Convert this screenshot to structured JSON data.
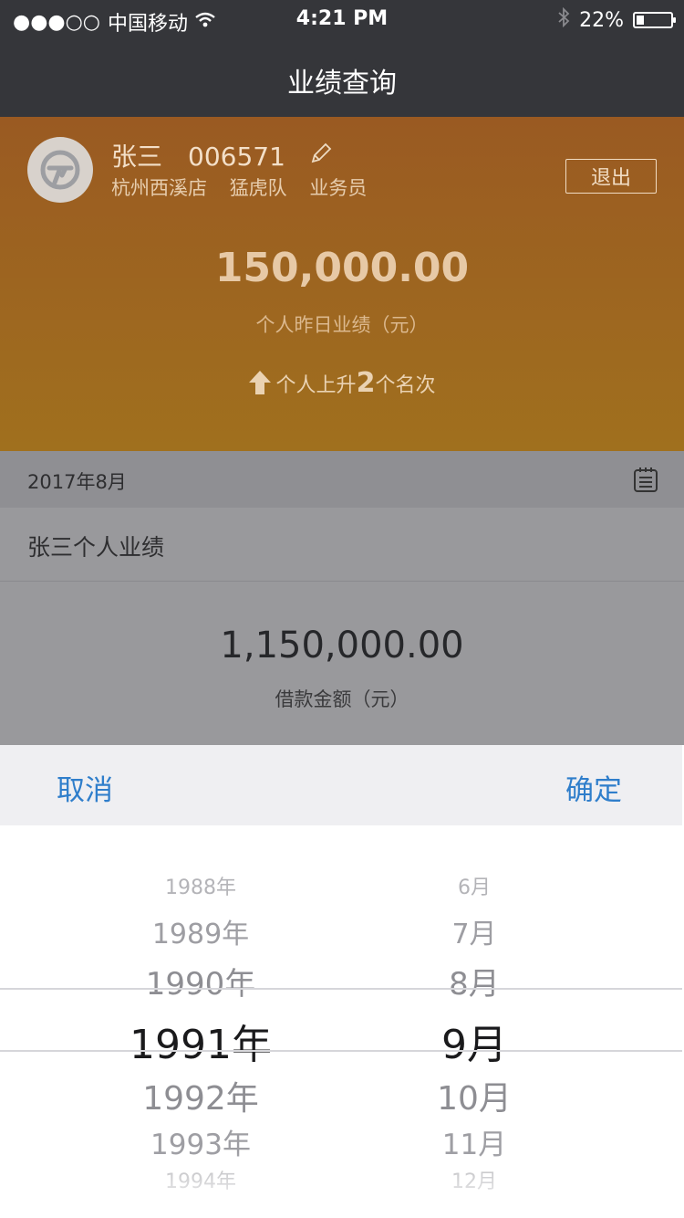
{
  "status_bar": {
    "signal": "●●●○○",
    "carrier": "中国移动",
    "time": "4:21 PM",
    "battery": "22%",
    "battery_level": 0.22
  },
  "nav": {
    "title": "业绩查询"
  },
  "profile": {
    "name": "张三",
    "employee_id": "006571",
    "store": "杭州西溪店",
    "team": "猛虎队",
    "role": "业务员",
    "logout_label": "退出"
  },
  "summary": {
    "amount": "150,000.00",
    "amount_label": "个人昨日业绩（元）",
    "rank_prefix": "个人上升",
    "rank_number": "2",
    "rank_suffix": "个名次"
  },
  "section": {
    "month": "2017年8月",
    "title": "张三个人业绩",
    "loan_amount": "1,150,000.00",
    "loan_label": "借款金额（元）"
  },
  "picker": {
    "cancel_label": "取消",
    "confirm_label": "确定",
    "years": [
      "1988年",
      "1989年",
      "1990年",
      "1991年",
      "1992年",
      "1993年",
      "1994年"
    ],
    "months": [
      "6月",
      "7月",
      "8月",
      "9月",
      "10月",
      "11月",
      "12月"
    ],
    "selected_year": "1991年",
    "selected_month": "9月"
  },
  "colors": {
    "accent": "#2f7ecb",
    "header": "#9e6a20",
    "topbar": "#35363a"
  }
}
